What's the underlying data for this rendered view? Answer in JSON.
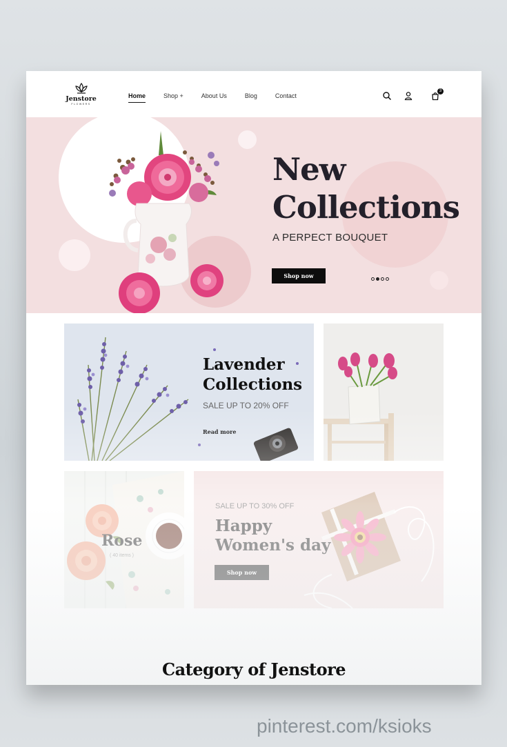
{
  "brand": {
    "name": "Jenstore",
    "tagline": "FLOWERS"
  },
  "nav": {
    "items": [
      {
        "label": "Home",
        "active": true
      },
      {
        "label": "Shop +",
        "active": false
      },
      {
        "label": "About Us",
        "active": false
      },
      {
        "label": "Blog",
        "active": false
      },
      {
        "label": "Contact",
        "active": false
      }
    ]
  },
  "header_icons": [
    "search-icon",
    "user-icon",
    "bag-icon"
  ],
  "cart": {
    "count": "3"
  },
  "hero": {
    "title_line1": "New",
    "title_line2": "Collections",
    "subtitle": "A PERPECT BOUQUET",
    "button": "Shop now",
    "slides": 4,
    "active_slide": 2
  },
  "promos": {
    "lavender": {
      "title_line1": "Lavender",
      "title_line2": "Collections",
      "subtitle": "SALE UP TO 20% OFF",
      "link": "Read more"
    },
    "rose": {
      "title": "Rose",
      "count": "( 40 items )"
    },
    "womens_day": {
      "subtitle": "SALE UP TO 30% OFF",
      "title_line1": "Happy",
      "title_line2": "Women's day",
      "button": "Shop now"
    }
  },
  "category": {
    "title": "Category of Jenstore"
  },
  "watermark": "pinterest.com/ksioks",
  "colors": {
    "hero_bg": "#f3dfe0",
    "lavender_bg": "#dfe5ee",
    "womens_bg": "#f2dfdf",
    "accent_pink": "#e2467f",
    "button": "#0d0d0d"
  }
}
